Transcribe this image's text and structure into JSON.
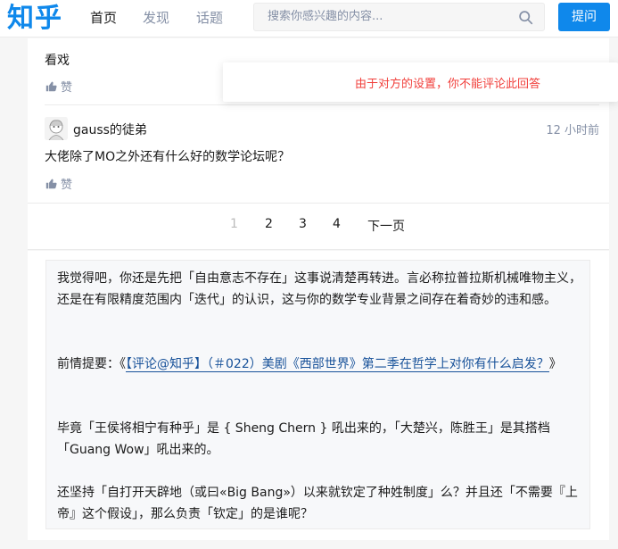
{
  "header": {
    "logo": "知乎",
    "nav": [
      "首页",
      "发现",
      "话题"
    ],
    "search_placeholder": "搜索你感兴趣的内容...",
    "ask_label": "提问"
  },
  "comments": [
    {
      "text": "看戏",
      "like_label": "赞"
    },
    {
      "author": "gauss的徒弟",
      "time": "12 小时前",
      "text": "大佬除了MO之外还有什么好的数学论坛呢？",
      "like_label": "赞"
    }
  ],
  "toast": "由于对方的设置，你不能评论此回答",
  "pagination": {
    "pages": [
      "1",
      "2",
      "3",
      "4"
    ],
    "next_label": "下一页",
    "current": "1"
  },
  "quote": {
    "p1": "我觉得吧，你还是先把「自由意志不存在」这事说清楚再转进。言必称拉普拉斯机械唯物主义，还是在有限精度范围内「迭代」的认识，这与你的数学专业背景之间存在着奇妙的违和感。",
    "p2_prefix": "前情提要：《",
    "p2_link": "【评论@知乎】（＃022）美剧《西部世界》第二季在哲学上对你有什么启发？",
    "p2_suffix": "》",
    "p3": "毕竟「王侯将相宁有种乎」是 { Sheng Chern } 吼出来的，「大楚兴，陈胜王」是其搭档「Guang Wow」吼出来的。",
    "p4": "还坚持「自打开天辟地（或曰«Big Bang»）以来就钦定了种姓制度」么？并且还「不需要『上帝』这个假设」，那么负责「钦定」的是谁呢？"
  },
  "colors": {
    "brand": "#0f88eb",
    "warning": "#f1403c",
    "link": "#175199"
  }
}
